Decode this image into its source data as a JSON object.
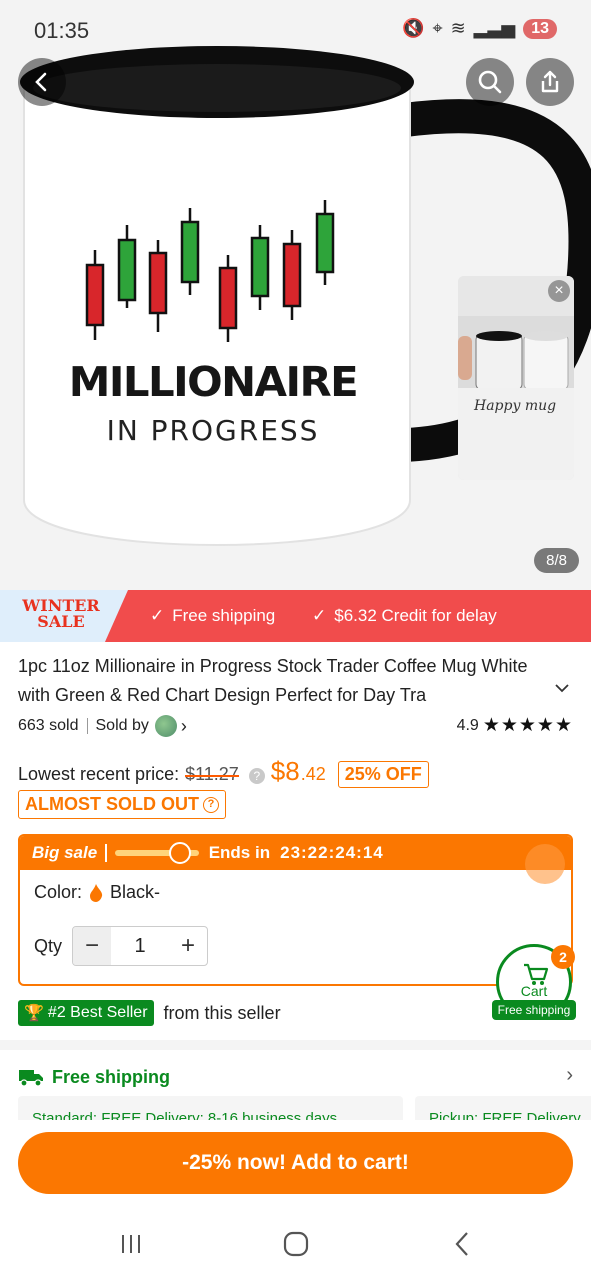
{
  "status_bar": {
    "time": "01:35",
    "notification_count": "13"
  },
  "hero": {
    "mug_text_main": "MILLIONAIRE",
    "mug_text_sub": "IN PROGRESS",
    "video_caption": "Happy mug",
    "page_indicator": "8/8"
  },
  "promo": {
    "badge_line1": "WINTER",
    "badge_line2": "SALE",
    "item1": "Free shipping",
    "item2": "$6.32 Credit for delay"
  },
  "product": {
    "title": "1pc 11oz Millionaire in Progress Stock Trader Coffee Mug White with Green & Red Chart Design Perfect for Day Tra",
    "sold": "663 sold",
    "sold_by": "Sold by",
    "rating": "4.9",
    "stars": "★★★★★",
    "price_label": "Lowest recent price:",
    "old_price": "$11.27",
    "price_main": "$8",
    "price_cents": ".42",
    "discount": "25% OFF",
    "stock_badge": "ALMOST SOLD OUT"
  },
  "sale": {
    "title": "Big sale",
    "ends_label": "Ends in",
    "timer": "23:22:24:14",
    "color_label": "Color:",
    "color_value": "Black-",
    "qty_label": "Qty",
    "qty_value": "1"
  },
  "cart": {
    "label": "Cart",
    "count": "2",
    "shipping_tag": "Free shipping"
  },
  "bestseller": {
    "badge": "#2 Best Seller",
    "suffix": "from this seller"
  },
  "shipping": {
    "title": "Free shipping",
    "card1": "Standard: FREE  Delivery: 8-16 business days",
    "card2": "Pickup: FREE  Delivery"
  },
  "cta": {
    "label": "-25% now! Add to cart!"
  },
  "colors": {
    "accent": "#fb7701",
    "green": "#0a8a1f",
    "promo_red": "#f14c4c"
  }
}
